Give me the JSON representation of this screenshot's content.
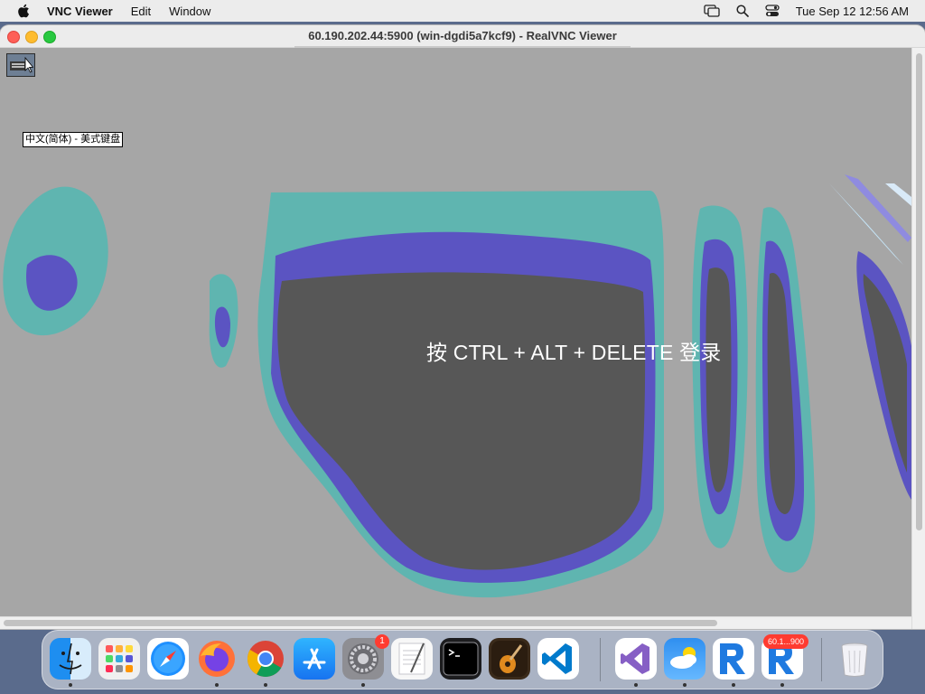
{
  "menubar": {
    "app_name": "VNC Viewer",
    "items": [
      "Edit",
      "Window"
    ],
    "clock": "Tue Sep 12  12:56 AM"
  },
  "window": {
    "title": "60.190.202.44:5900 (win-dgdi5a7kcf9) - RealVNC Viewer"
  },
  "remote_screen": {
    "ime_indicator": "中文(简体) - 美式键盘",
    "login_prompt": "按 CTRL + ALT + DELETE 登录"
  },
  "dock": {
    "items": [
      {
        "name": "Finder",
        "icon": "finder-icon",
        "running": true
      },
      {
        "name": "Launchpad",
        "icon": "launchpad-icon",
        "running": false
      },
      {
        "name": "Safari",
        "icon": "safari-icon",
        "running": false
      },
      {
        "name": "Firefox",
        "icon": "firefox-icon",
        "running": true
      },
      {
        "name": "Google Chrome",
        "icon": "chrome-icon",
        "running": true
      },
      {
        "name": "App Store",
        "icon": "app-store-icon",
        "running": false
      },
      {
        "name": "System Preferences",
        "icon": "system-preferences-icon",
        "running": true,
        "badge": "1"
      },
      {
        "name": "TextEdit",
        "icon": "textedit-icon",
        "running": false
      },
      {
        "name": "Terminal",
        "icon": "terminal-icon",
        "running": false
      },
      {
        "name": "GarageBand",
        "icon": "garageband-icon",
        "running": false
      },
      {
        "name": "Visual Studio Code",
        "icon": "vscode-icon",
        "running": false
      },
      {
        "name": "Visual Studio",
        "icon": "visual-studio-icon",
        "running": true
      },
      {
        "name": "Weather",
        "icon": "weather-icon",
        "running": true
      },
      {
        "name": "VNC Viewer",
        "icon": "vnc-viewer-icon",
        "running": true
      },
      {
        "name": "VNC Session",
        "icon": "vnc-session-icon",
        "running": true,
        "badge": "60.1...900"
      },
      {
        "name": "Trash",
        "icon": "trash-icon",
        "running": false
      }
    ]
  },
  "colors": {
    "remote_background": "#a6a6a6",
    "wallpaper_dark": "#575757",
    "wallpaper_purple": "#5b54c2",
    "wallpaper_teal": "#5fb5b0"
  }
}
